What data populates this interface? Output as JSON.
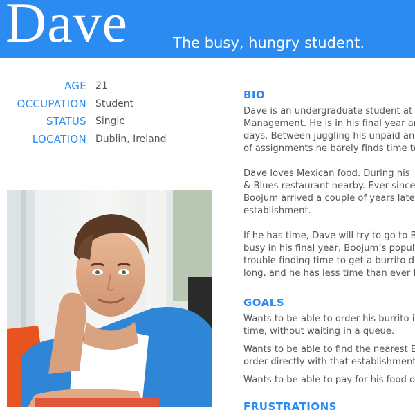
{
  "header": {
    "name": "Dave",
    "tagline": "The busy, hungry student."
  },
  "facts": [
    {
      "label": "AGE",
      "value": "21"
    },
    {
      "label": "OCCUPATION",
      "value": "Student"
    },
    {
      "label": "STATUS",
      "value": "Single"
    },
    {
      "label": "LOCATION",
      "value": "Dublin, Ireland"
    }
  ],
  "bio": {
    "title": "BIO",
    "paragraphs": [
      [
        "Dave is an undergraduate student at D",
        "Management. He is in his final year ar",
        "days. Between juggling his unpaid and",
        "of assignments he barely finds time to"
      ],
      [
        "Dave loves Mexican food. During his",
        "& Blues restaurant nearby. Ever since t",
        "Boojum arrived a couple of years later",
        "establishment."
      ],
      [
        "If he has time, Dave will try to go to Bo",
        "busy in his final year, Boojum’s popula",
        "trouble finding time to get a burrito du",
        "long, and he has less time than ever fo"
      ]
    ]
  },
  "goals": {
    "title": "GOALS",
    "items": [
      [
        "Wants to be able to order his burrito in",
        "time, without waiting in a queue."
      ],
      [
        "Wants to be able to find the nearest Bo",
        "order directly with that establishment."
      ],
      [
        "Wants to be able to pay for his food or"
      ]
    ]
  },
  "frustrations": {
    "title": "FRUSTRATIONS"
  },
  "colors": {
    "accent": "#2c8bf0",
    "body_text": "#555555"
  }
}
